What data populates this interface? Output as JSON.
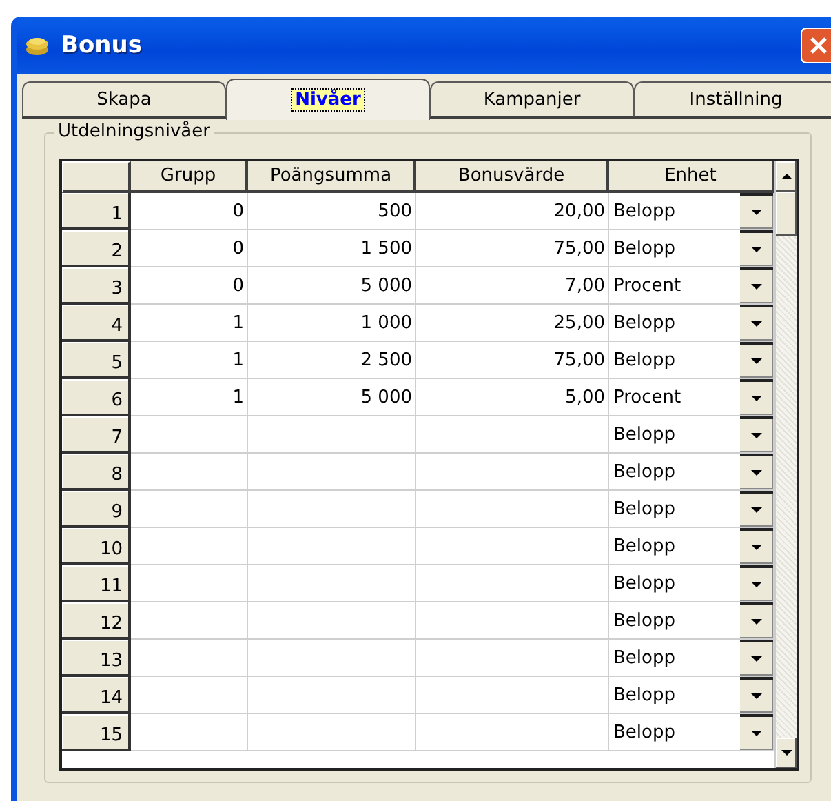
{
  "window": {
    "title": "Bonus"
  },
  "tabs": [
    {
      "label": "Skapa",
      "selected": false
    },
    {
      "label": "Nivåer",
      "selected": true
    },
    {
      "label": "Kampanjer",
      "selected": false
    },
    {
      "label": "Inställning",
      "selected": false
    }
  ],
  "group": {
    "label": "Utdelningsnivåer"
  },
  "table": {
    "columns": [
      "Grupp",
      "Poängsumma",
      "Bonusvärde",
      "Enhet"
    ],
    "rows": [
      {
        "number": "1",
        "grupp": "0",
        "poangsumma": "500",
        "bonusvarde": "20,00",
        "enhet": "Belopp"
      },
      {
        "number": "2",
        "grupp": "0",
        "poangsumma": "1 500",
        "bonusvarde": "75,00",
        "enhet": "Belopp"
      },
      {
        "number": "3",
        "grupp": "0",
        "poangsumma": "5 000",
        "bonusvarde": "7,00",
        "enhet": "Procent"
      },
      {
        "number": "4",
        "grupp": "1",
        "poangsumma": "1 000",
        "bonusvarde": "25,00",
        "enhet": "Belopp"
      },
      {
        "number": "5",
        "grupp": "1",
        "poangsumma": "2 500",
        "bonusvarde": "75,00",
        "enhet": "Belopp"
      },
      {
        "number": "6",
        "grupp": "1",
        "poangsumma": "5 000",
        "bonusvarde": "5,00",
        "enhet": "Procent"
      },
      {
        "number": "7",
        "enhet": "Belopp"
      },
      {
        "number": "8",
        "enhet": "Belopp"
      },
      {
        "number": "9",
        "enhet": "Belopp"
      },
      {
        "number": "10",
        "enhet": "Belopp"
      },
      {
        "number": "11",
        "enhet": "Belopp"
      },
      {
        "number": "12",
        "enhet": "Belopp"
      },
      {
        "number": "13",
        "enhet": "Belopp"
      },
      {
        "number": "14",
        "enhet": "Belopp"
      },
      {
        "number": "15",
        "enhet": "Belopp"
      }
    ]
  }
}
